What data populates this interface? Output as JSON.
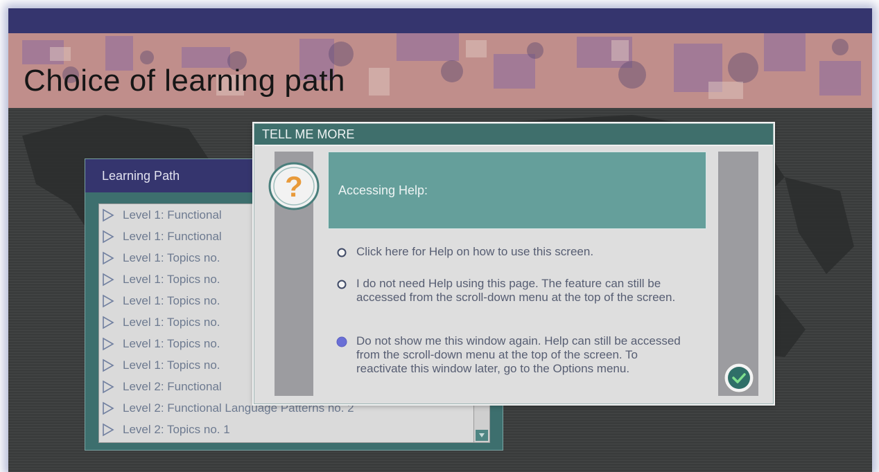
{
  "page": {
    "title": "Choice of learning path"
  },
  "learning_path": {
    "title": "Learning Path",
    "items": [
      "Level 1: Functional",
      "Level 1: Functional",
      "Level 1: Topics no.",
      "Level 1: Topics no.",
      "Level 1: Topics no.",
      "Level 1: Topics no.",
      "Level 1: Topics no.",
      "Level 1: Topics no.",
      "Level 2: Functional",
      "Level 2: Functional Language Patterns no. 2",
      "Level 2: Topics no. 1"
    ]
  },
  "dialog": {
    "title": "TELL ME MORE",
    "heading": "Accessing Help:",
    "options": [
      {
        "text": "Click here for Help on how to use this screen.",
        "selected": false
      },
      {
        "text": "I do not need Help using this page. The feature can still be accessed from the scroll-down menu at the top of the screen.",
        "selected": false
      },
      {
        "text": "Do not show me this window again. Help can still be accessed from the scroll-down menu at the top of the screen. To reactivate this window later, go to the Options menu.",
        "selected": true
      }
    ],
    "help_icon": "question-mark-icon",
    "ok_icon": "checkmark-icon"
  },
  "colors": {
    "title_bar": "#35356e",
    "dialog_accent": "#3f6f6c",
    "radio_selected": "#6a6fd6"
  }
}
